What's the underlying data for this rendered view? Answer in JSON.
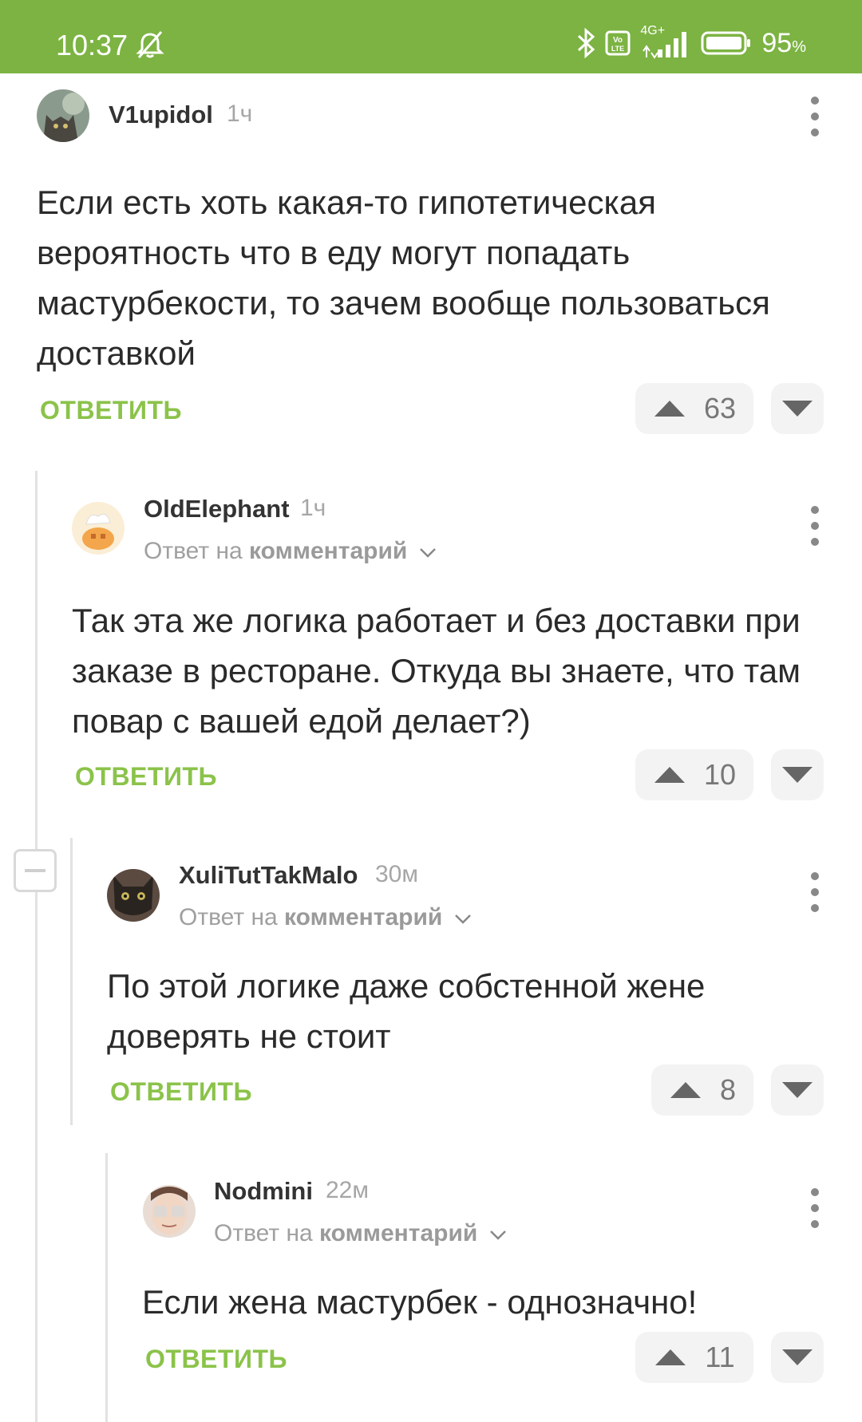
{
  "status_bar": {
    "time": "10:37",
    "network": "4G+",
    "battery": "95",
    "battery_unit": "%"
  },
  "comments": [
    {
      "username": "V1upidol",
      "time": "1ч",
      "text": "Если есть хоть какая-то гипотетическая вероятность что в еду могут попадать мастурбекости, то зачем вообще пользоваться доставкой",
      "reply_label": "ОТВЕТИТЬ",
      "votes": "63"
    },
    {
      "username": "OldElephant",
      "time": "1ч",
      "reply_prefix": "Ответ на",
      "reply_target": "комментарий",
      "text": "Так эта же логика работает и без доставки при заказе в ресторане. Откуда вы знаете, что там повар с вашей едой делает?)",
      "reply_label": "ОТВЕТИТЬ",
      "votes": "10"
    },
    {
      "username": "XuliTutTakMalo",
      "time": "30м",
      "reply_prefix": "Ответ на",
      "reply_target": "комментарий",
      "text": "По этой логике даже собстенной жене доверять не стоит",
      "reply_label": "ОТВЕТИТЬ",
      "votes": "8"
    },
    {
      "username": "Nodmini",
      "time": "22м",
      "reply_prefix": "Ответ на",
      "reply_target": "комментарий",
      "text": "Если жена мастурбек - однозначно!",
      "reply_label": "ОТВЕТИТЬ",
      "votes": "11"
    }
  ],
  "colors": {
    "accent": "#8bc34a",
    "status_bar": "#7cb342"
  }
}
